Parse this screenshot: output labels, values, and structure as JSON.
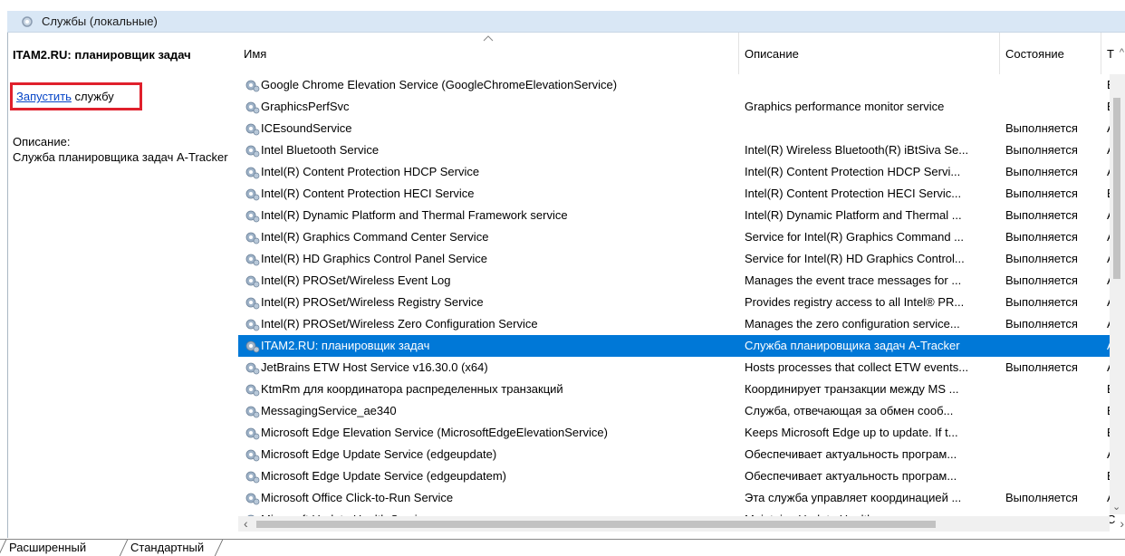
{
  "window": {
    "title": "Службы (локальные)"
  },
  "left_pane": {
    "service_title": "ITAM2.RU: планировщик задач",
    "action_link": "Запустить",
    "action_suffix": " службу",
    "description_label": "Описание:",
    "description_text": "Служба планировщика задач A-Tracker"
  },
  "columns": {
    "name": "Имя",
    "description": "Описание",
    "state": "Состояние",
    "type": "Т"
  },
  "rows": [
    {
      "name": "Google Chrome Elevation Service (GoogleChromeElevationService)",
      "description": "",
      "state": "",
      "type": "В"
    },
    {
      "name": "GraphicsPerfSvc",
      "description": "Graphics performance monitor service",
      "state": "",
      "type": "В"
    },
    {
      "name": "ICEsoundService",
      "description": "",
      "state": "Выполняется",
      "type": "А"
    },
    {
      "name": "Intel Bluetooth Service",
      "description": "Intel(R) Wireless Bluetooth(R) iBtSiva Se...",
      "state": "Выполняется",
      "type": "А"
    },
    {
      "name": "Intel(R) Content Protection HDCP Service",
      "description": "Intel(R) Content Protection HDCP Servi...",
      "state": "Выполняется",
      "type": "А"
    },
    {
      "name": "Intel(R) Content Protection HECI Service",
      "description": "Intel(R) Content Protection HECI Servic...",
      "state": "Выполняется",
      "type": "В"
    },
    {
      "name": "Intel(R) Dynamic Platform and Thermal Framework service",
      "description": "Intel(R) Dynamic Platform and Thermal ...",
      "state": "Выполняется",
      "type": "А"
    },
    {
      "name": "Intel(R) Graphics Command Center Service",
      "description": "Service for Intel(R) Graphics Command ...",
      "state": "Выполняется",
      "type": "А"
    },
    {
      "name": "Intel(R) HD Graphics Control Panel Service",
      "description": "Service for Intel(R) HD Graphics Control...",
      "state": "Выполняется",
      "type": "А"
    },
    {
      "name": "Intel(R) PROSet/Wireless Event Log",
      "description": "Manages the event trace messages for ...",
      "state": "Выполняется",
      "type": "А"
    },
    {
      "name": "Intel(R) PROSet/Wireless Registry Service",
      "description": "Provides registry access to all Intel® PR...",
      "state": "Выполняется",
      "type": "А"
    },
    {
      "name": "Intel(R) PROSet/Wireless Zero Configuration Service",
      "description": "Manages the zero configuration service...",
      "state": "Выполняется",
      "type": "А"
    },
    {
      "name": "ITAM2.RU: планировщик задач",
      "description": "Служба планировщика задач A-Tracker",
      "state": "",
      "type": "А",
      "selected": true
    },
    {
      "name": "JetBrains ETW Host Service v16.30.0 (x64)",
      "description": "Hosts processes that collect ETW events...",
      "state": "Выполняется",
      "type": "А"
    },
    {
      "name": "KtmRm для координатора распределенных транзакций",
      "description": "Координирует транзакции между MS ...",
      "state": "",
      "type": "В"
    },
    {
      "name": "MessagingService_ae340",
      "description": "Служба, отвечающая за обмен сооб...",
      "state": "",
      "type": "В"
    },
    {
      "name": "Microsoft Edge Elevation Service (MicrosoftEdgeElevationService)",
      "description": "Keeps Microsoft Edge up to update. If t...",
      "state": "",
      "type": "В"
    },
    {
      "name": "Microsoft Edge Update Service (edgeupdate)",
      "description": "Обеспечивает актуальность програм...",
      "state": "",
      "type": "А"
    },
    {
      "name": "Microsoft Edge Update Service (edgeupdatem)",
      "description": "Обеспечивает актуальность програм...",
      "state": "",
      "type": "В"
    },
    {
      "name": "Microsoft Office Click-to-Run Service",
      "description": "Эта служба управляет координацией ...",
      "state": "Выполняется",
      "type": "А"
    },
    {
      "name": "Microsoft Update Health Service",
      "description": "Maintains Update Health",
      "state": "",
      "type": "С"
    }
  ],
  "tabs": [
    {
      "label": "Расширенный"
    },
    {
      "label": "Стандартный"
    }
  ]
}
